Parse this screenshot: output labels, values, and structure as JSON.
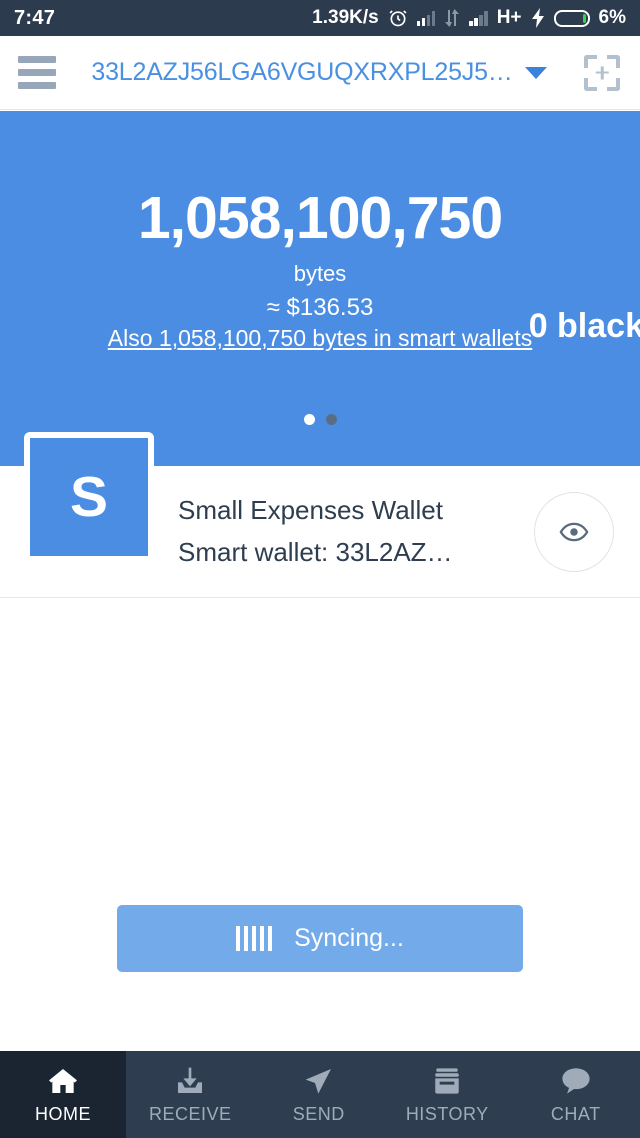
{
  "status_bar": {
    "time": "7:47",
    "network_speed": "1.39K/s",
    "alarm_icon": "alarm-clock-icon",
    "signal_icon": "signal-bars-icon",
    "data_transfer_icon": "data-transfer-icon",
    "network_type": "H+",
    "charging_icon": "lightning-bolt-icon",
    "battery_icon": "battery-icon",
    "battery_percent": "6%"
  },
  "appbar": {
    "menu_icon": "hamburger-menu-icon",
    "address": "33L2AZJ56LGA6VGUQXRXPL25J5…",
    "dropdown_icon": "chevron-down-icon",
    "scan_icon": "qr-scan-icon"
  },
  "hero": {
    "balance": "1,058,100,750",
    "unit": "bytes",
    "fiat": "≈ $136.53",
    "smart_wallets_link": "Also 1,058,100,750 bytes in smart wallets",
    "next_page_peek": "0 black",
    "pager": {
      "total": 2,
      "active": 0
    }
  },
  "wallet_card": {
    "avatar_letter": "S",
    "title": "Small Expenses Wallet",
    "subtitle": "Smart wallet: 33L2AZ…",
    "eye_icon": "eye-icon"
  },
  "sync": {
    "label": "Syncing...",
    "spinner_icon": "loading-bars-icon",
    "button_color": "#73aae9"
  },
  "bottom_nav": {
    "items": [
      {
        "label": "HOME",
        "icon": "home-icon",
        "active": true
      },
      {
        "label": "RECEIVE",
        "icon": "download-icon",
        "active": false
      },
      {
        "label": "SEND",
        "icon": "paper-plane-icon",
        "active": false
      },
      {
        "label": "HISTORY",
        "icon": "archive-box-icon",
        "active": false
      },
      {
        "label": "CHAT",
        "icon": "speech-bubble-icon",
        "active": false
      }
    ]
  },
  "colors": {
    "accent_blue": "#4a8de3",
    "link_blue": "#4a90e2",
    "nav_bg": "#2e3d4f",
    "nav_active_bg": "#1b2431",
    "status_bg": "#2d3b4e"
  }
}
